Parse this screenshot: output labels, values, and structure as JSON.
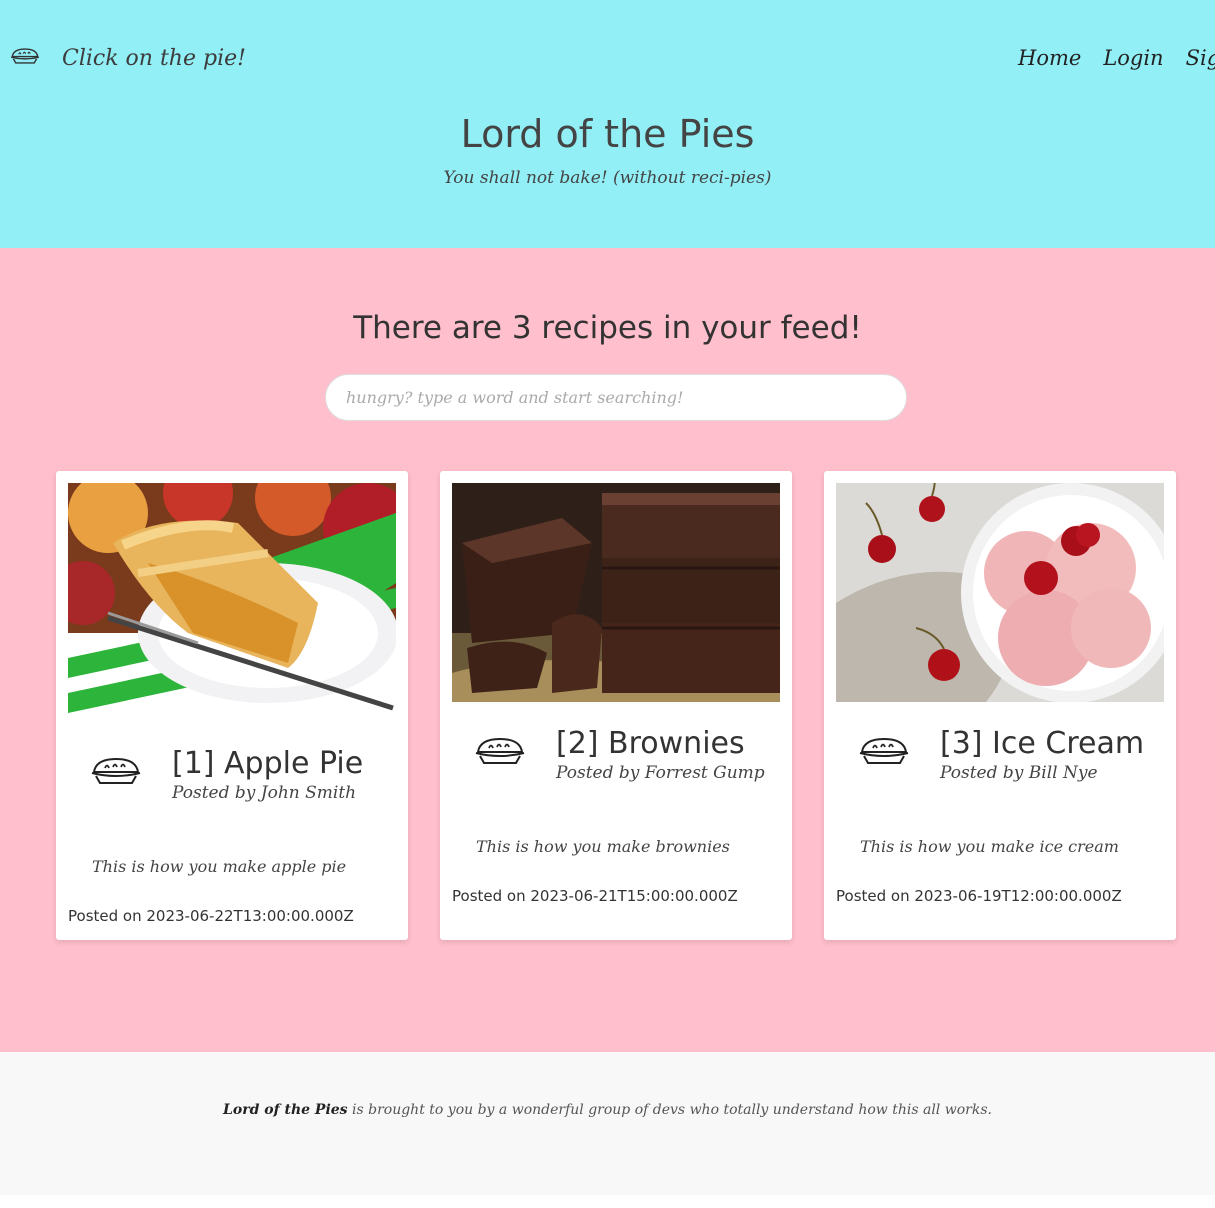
{
  "header": {
    "brand_text": "Click on the pie!",
    "nav": [
      "Home",
      "Login",
      "Signup"
    ],
    "title": "Lord of the Pies",
    "subtitle": "You shall not bake! (without reci-pies)"
  },
  "feed": {
    "heading": "There are 3 recipes in your feed!",
    "search_placeholder": "hungry? type a word and start searching!"
  },
  "recipes": [
    {
      "title": "[1] Apple Pie",
      "author": "Posted by John Smith",
      "description": "This is how you make apple pie",
      "date": "Posted on 2023-06-22T13:00:00.000Z"
    },
    {
      "title": "[2] Brownies",
      "author": "Posted by Forrest Gump",
      "description": "This is how you make brownies",
      "date": "Posted on 2023-06-21T15:00:00.000Z"
    },
    {
      "title": "[3] Ice Cream",
      "author": "Posted by Bill Nye",
      "description": "This is how you make ice cream",
      "date": "Posted on 2023-06-19T12:00:00.000Z"
    }
  ],
  "footer": {
    "brand": "Lord of the Pies",
    "text": " is brought to you by a wonderful group of devs who totally understand how this all works."
  },
  "colors": {
    "header_bg": "#92eff6",
    "main_bg": "#ffbfcc",
    "footer_bg": "#f8f8f8"
  },
  "icons": {
    "brand": "pie-icon",
    "card": "pie-icon"
  }
}
